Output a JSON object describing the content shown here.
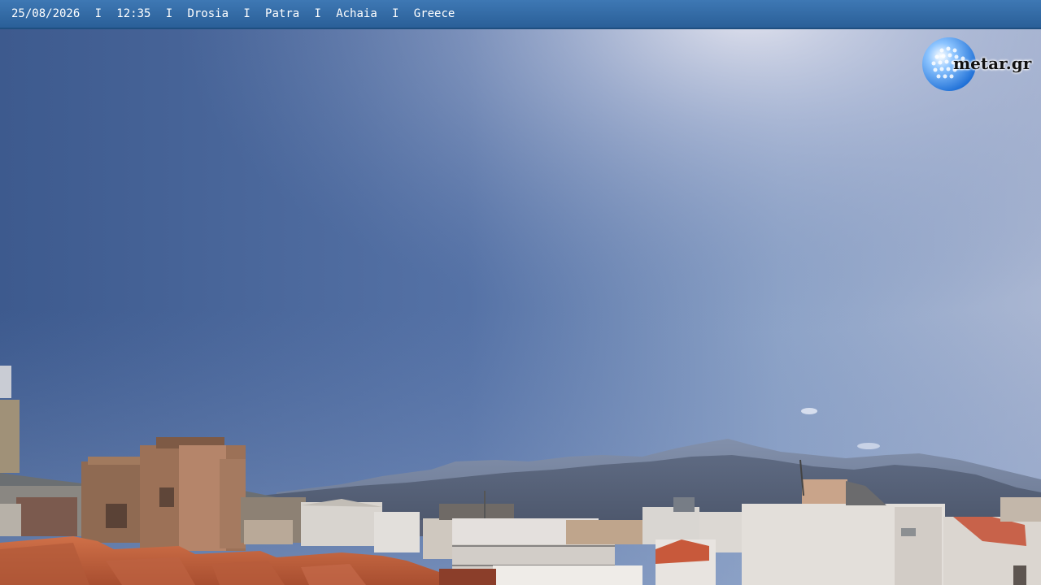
{
  "overlay": {
    "date": "25/08/2026",
    "time": "12:35",
    "area": "Drosia",
    "city": "Patra",
    "region": "Achaia",
    "country": "Greece",
    "separator": "I"
  },
  "logo": {
    "text": "metar.gr"
  },
  "colors": {
    "bar": "#2f6aa6",
    "sky_top": "#3f5e92",
    "sky_bright": "#c9cde0",
    "mountains": "#5d6880",
    "roof_tiles": "#c5653f",
    "buildings": "#d9d4cc"
  },
  "icons": {
    "logo_globe": "globe-icon"
  }
}
